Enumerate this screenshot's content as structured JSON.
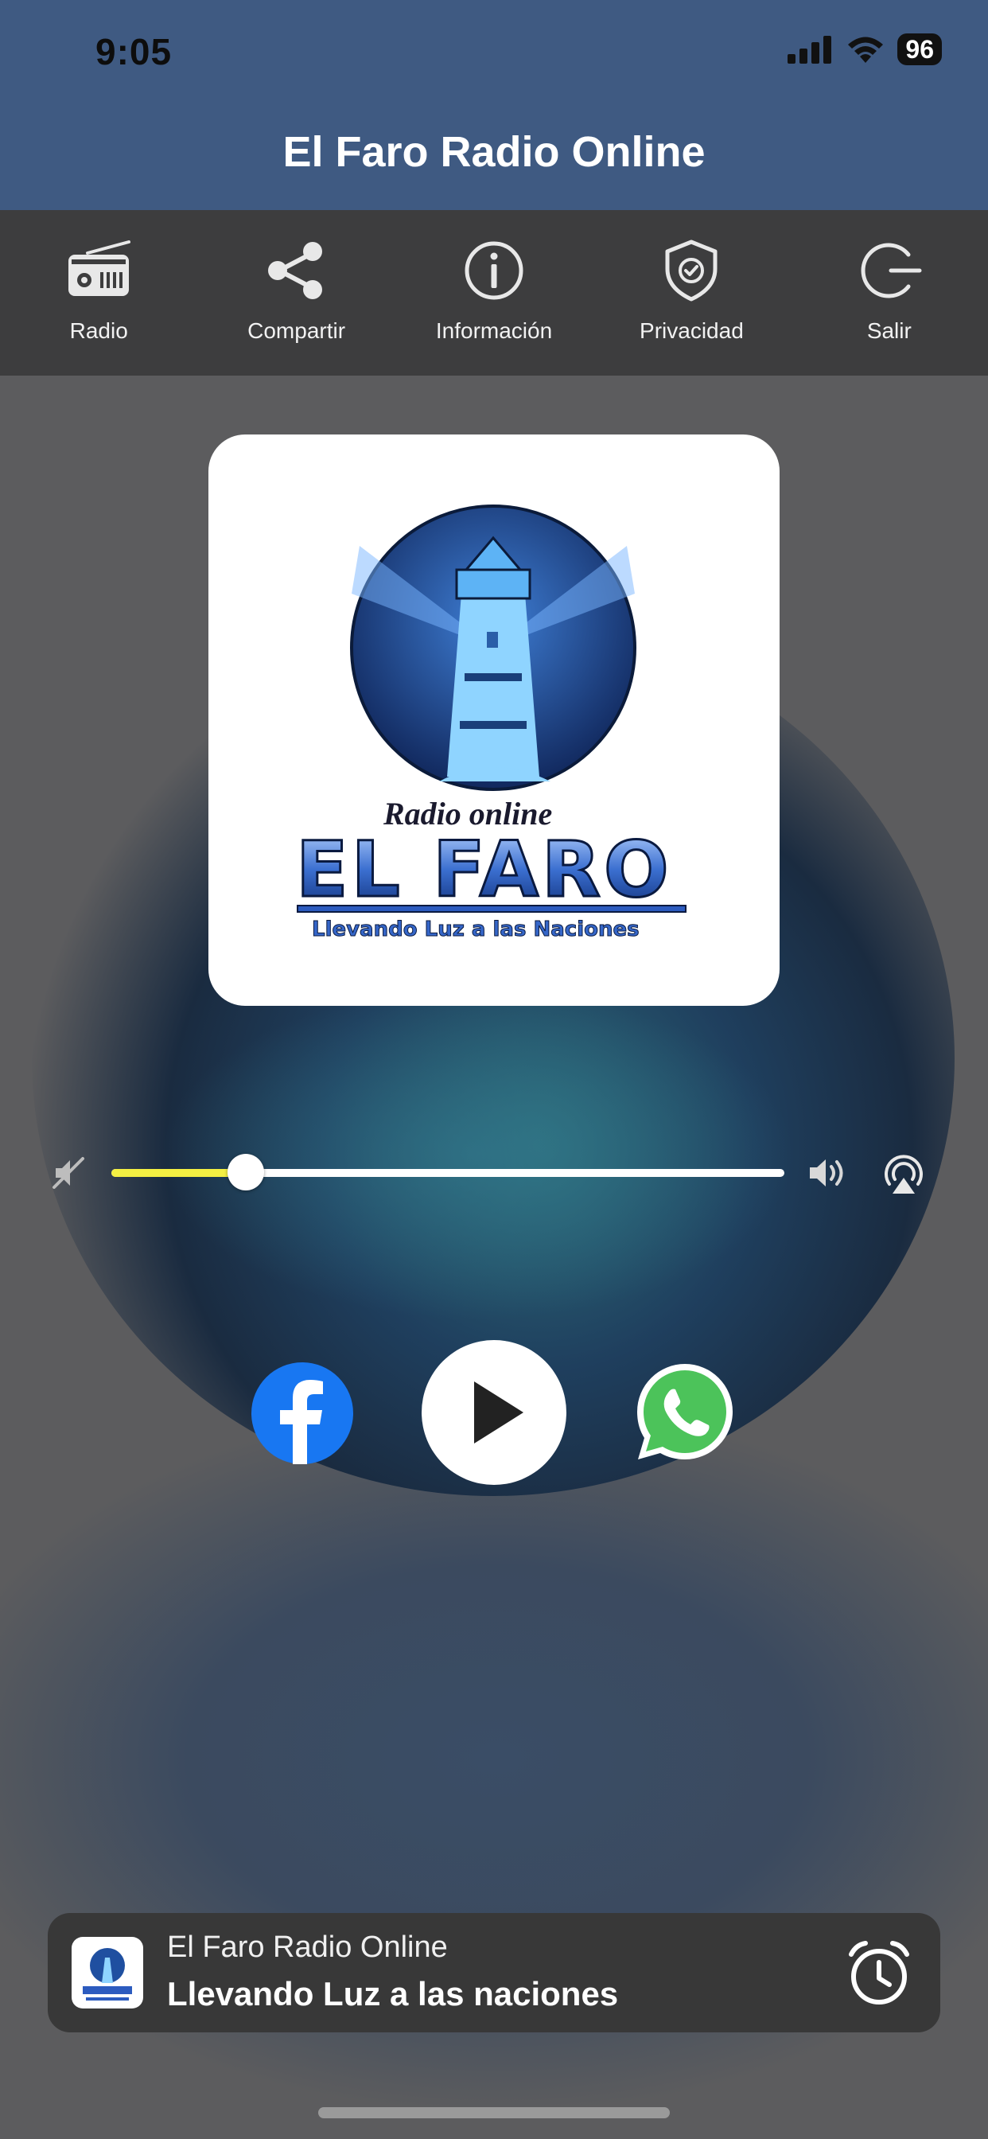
{
  "status_bar": {
    "time": "9:05",
    "battery": "96",
    "icons": [
      "signal-icon",
      "wifi-icon",
      "battery-icon"
    ]
  },
  "header": {
    "title": "El Faro Radio Online"
  },
  "toolbar": {
    "items": [
      {
        "label": "Radio",
        "icon": "radio-icon"
      },
      {
        "label": "Compartir",
        "icon": "share-icon"
      },
      {
        "label": "Información",
        "icon": "info-icon"
      },
      {
        "label": "Privacidad",
        "icon": "shield-icon"
      },
      {
        "label": "Salir",
        "icon": "exit-icon"
      }
    ]
  },
  "artwork": {
    "logo_text": "Radio online EL FARO Llevando Luz a las Naciones"
  },
  "volume": {
    "level": 0.2
  },
  "controls": {
    "facebook": "facebook-icon",
    "play": "play-icon",
    "whatsapp": "whatsapp-icon"
  },
  "now_playing": {
    "station": "El Faro Radio Online",
    "subtitle": "Llevando Luz a las naciones",
    "timer_icon": "alarm-clock-icon"
  },
  "colors": {
    "header": "#3f5a82",
    "toolbar": "#3d3d3e",
    "volume_fill": "#f4f043",
    "facebook": "#1877f2",
    "whatsapp": "#4cc35a"
  }
}
